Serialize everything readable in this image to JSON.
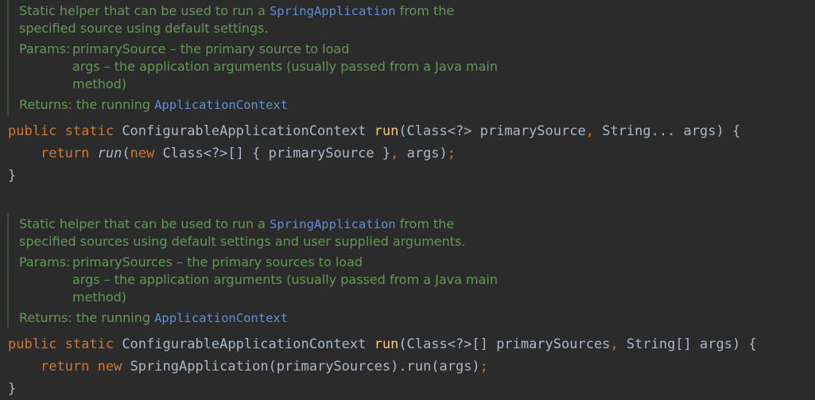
{
  "docs": [
    {
      "desc1_pre": "Static helper that can be used to run a ",
      "desc1_code": "SpringApplication",
      "desc1_post": " from the",
      "desc2": "specified source using default settings.",
      "params_label": "Params:",
      "param1": "primarySource – the primary source to load",
      "param2a": "args – the application arguments (usually passed from a Java main",
      "param2b": "method)",
      "returns_label": "Returns:",
      "returns_text": " the running ",
      "returns_code": "ApplicationContext"
    },
    {
      "desc1_pre": "Static helper that can be used to run a ",
      "desc1_code": "SpringApplication",
      "desc1_post": " from the",
      "desc2": "specified sources using default settings and user supplied arguments.",
      "params_label": "Params:",
      "param1": "primarySources – the primary sources to load",
      "param2a": "args – the application arguments (usually passed from a Java main",
      "param2b": "method)",
      "returns_label": "Returns:",
      "returns_text": " the running ",
      "returns_code": "ApplicationContext"
    }
  ],
  "code1": {
    "kw_public": "public",
    "kw_static": " static ",
    "ret_type": "ConfigurableApplicationContext ",
    "fn_name": "run",
    "sig": "(Class<?> primarySource",
    "comma": ", ",
    "sig2": "String... args) {",
    "body_indent": "    ",
    "kw_return": "return ",
    "call": "run",
    "paren": "(",
    "kw_new": "new ",
    "body_rest": "Class<?>[] { primarySource }",
    "comma2": ", ",
    "body_end": "args)",
    "semi": ";",
    "close": "}"
  },
  "code2": {
    "kw_public": "public",
    "kw_static": " static ",
    "ret_type": "ConfigurableApplicationContext ",
    "fn_name": "run",
    "sig": "(Class<?>[] primarySources",
    "comma": ", ",
    "sig2": "String[] args) {",
    "body_indent": "    ",
    "kw_return": "return ",
    "kw_new": "new ",
    "body_rest": "SpringApplication(primarySources).run(args)",
    "semi": ";",
    "close": "}"
  }
}
